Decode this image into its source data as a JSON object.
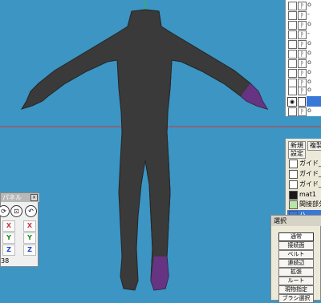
{
  "objects": [
    {
      "name": "o"
    },
    {
      "name": "-"
    },
    {
      "name": "o"
    },
    {
      "name": "-"
    },
    {
      "name": "o"
    },
    {
      "name": "o"
    },
    {
      "name": "o"
    },
    {
      "name": "o"
    },
    {
      "name": "o"
    },
    {
      "name": "o"
    },
    {
      "name": "o"
    }
  ],
  "material_panel": {
    "new_button": "新規",
    "copy_button": "複製",
    "settings_button": "設定",
    "materials": [
      {
        "name": "ガイド_前",
        "color": "#ffffff"
      },
      {
        "name": "ガイド_横",
        "color": "#ffffff"
      },
      {
        "name": "ガイド_後",
        "color": "#ffffff"
      },
      {
        "name": "mat1",
        "color": "#1a1a1a"
      },
      {
        "name": "間接部分",
        "color": "#b6e6a8"
      },
      {
        "name": "ハ",
        "color": "#3a78d8"
      }
    ]
  },
  "left_panel": {
    "title": "パネル",
    "close_label": "×",
    "axis_labels": [
      "X",
      "X",
      "Y",
      "Y",
      "Z",
      "Z"
    ],
    "value": "38"
  },
  "select_panel": {
    "title": "選択",
    "buttons": [
      "通常",
      "接続面",
      "ベルト",
      "連続辺",
      "拡張",
      "ルート",
      "現物指定",
      "ブラシ選択"
    ]
  },
  "colors": {
    "viewport_bg": "#3c95c3",
    "body_dark": "#3a3a3a",
    "wire": "#c070e0",
    "axis_red": "#c83c3c",
    "selection_blue": "#3a78d8"
  }
}
